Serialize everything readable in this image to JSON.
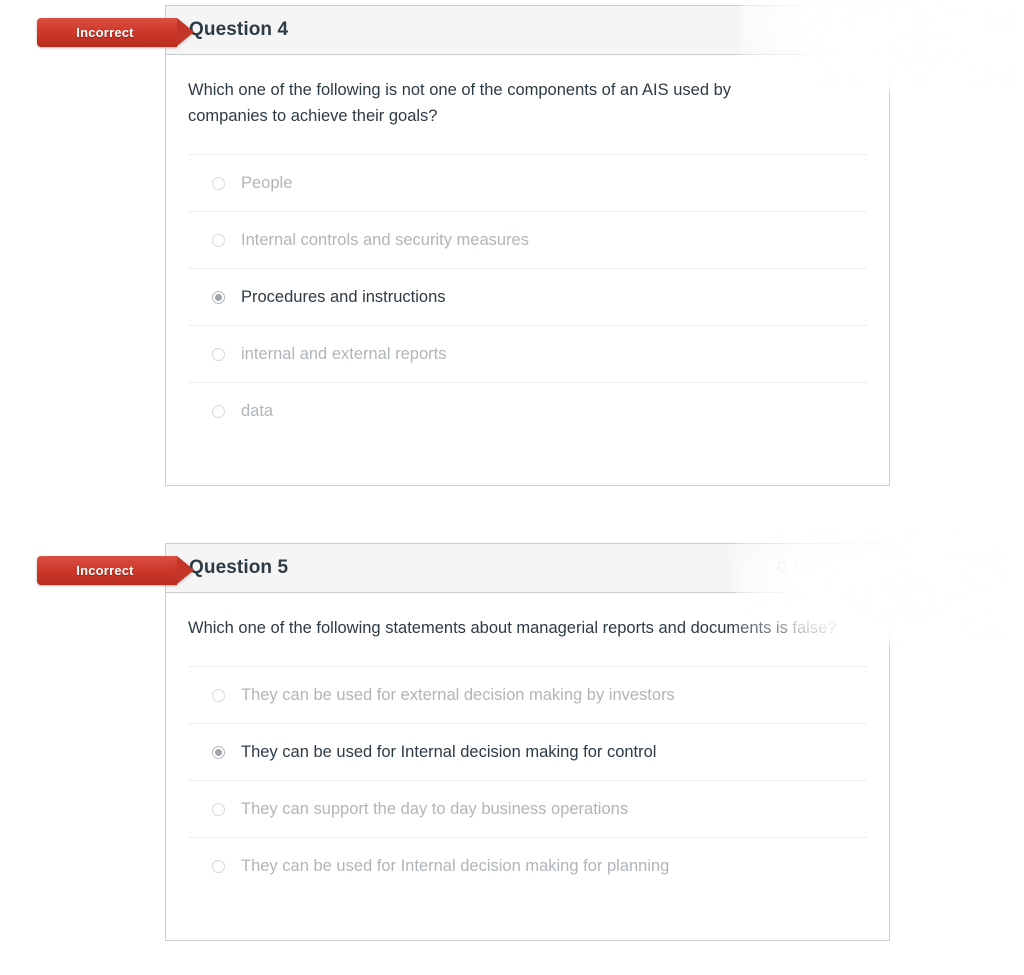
{
  "page": {
    "background_color": "#ffffff",
    "accent_color": "#c33527",
    "title_color": "#2d3b45"
  },
  "questions": [
    {
      "status_label": "Incorrect",
      "title": "Question 4",
      "score": "",
      "text": "Which one of the following is not one of the components of an AIS used by companies to achieve their goals?",
      "options": [
        {
          "label": "People",
          "selected": false
        },
        {
          "label": "Internal controls and security measures",
          "selected": false
        },
        {
          "label": "Procedures and instructions",
          "selected": true
        },
        {
          "label": "internal and external reports",
          "selected": false
        },
        {
          "label": "data",
          "selected": false
        }
      ]
    },
    {
      "status_label": "Incorrect",
      "title": "Question 5",
      "score": "0 /",
      "text": "Which one of the following statements about managerial reports and documents is false?",
      "options": [
        {
          "label": "They can be used for external decision making by investors",
          "selected": false
        },
        {
          "label": "They can be used for Internal decision making for control",
          "selected": true
        },
        {
          "label": "They can support the day to day business operations",
          "selected": false
        },
        {
          "label": "They can be used for Internal decision making for planning",
          "selected": false
        }
      ]
    }
  ]
}
